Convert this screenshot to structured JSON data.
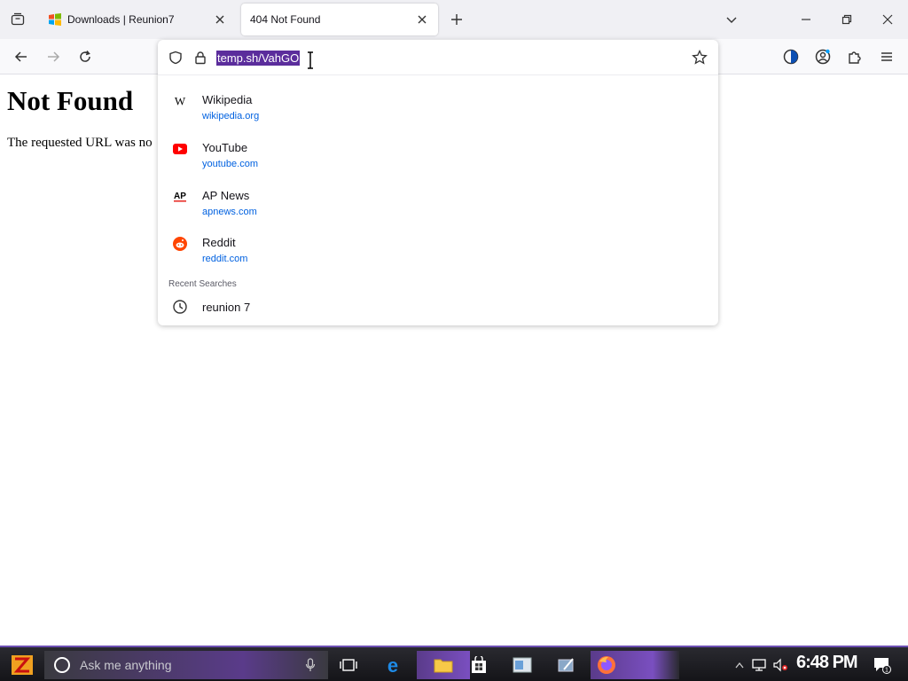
{
  "tabs": [
    {
      "title": "Downloads | Reunion7",
      "active": false
    },
    {
      "title": "404 Not Found",
      "active": true
    }
  ],
  "urlbar": {
    "value": "temp.sh/VahGO"
  },
  "page": {
    "heading": "Not Found",
    "message": "The requested URL was no"
  },
  "suggestions": [
    {
      "title": "Wikipedia",
      "url": "wikipedia.org",
      "icon": "wikipedia-icon"
    },
    {
      "title": "YouTube",
      "url": "youtube.com",
      "icon": "youtube-icon"
    },
    {
      "title": "AP News",
      "url": "apnews.com",
      "icon": "apnews-icon"
    },
    {
      "title": "Reddit",
      "url": "reddit.com",
      "icon": "reddit-icon"
    }
  ],
  "recent": {
    "header": "Recent Searches",
    "items": [
      {
        "text": "reunion 7",
        "icon": "clock-icon"
      }
    ]
  },
  "taskbar": {
    "search_placeholder": "Ask me anything",
    "clock": "6:48 PM",
    "notification_count": "1"
  },
  "colors": {
    "accent": "#5b2d9c",
    "link": "#0061e0",
    "taskbar": "#1a1a1f"
  }
}
